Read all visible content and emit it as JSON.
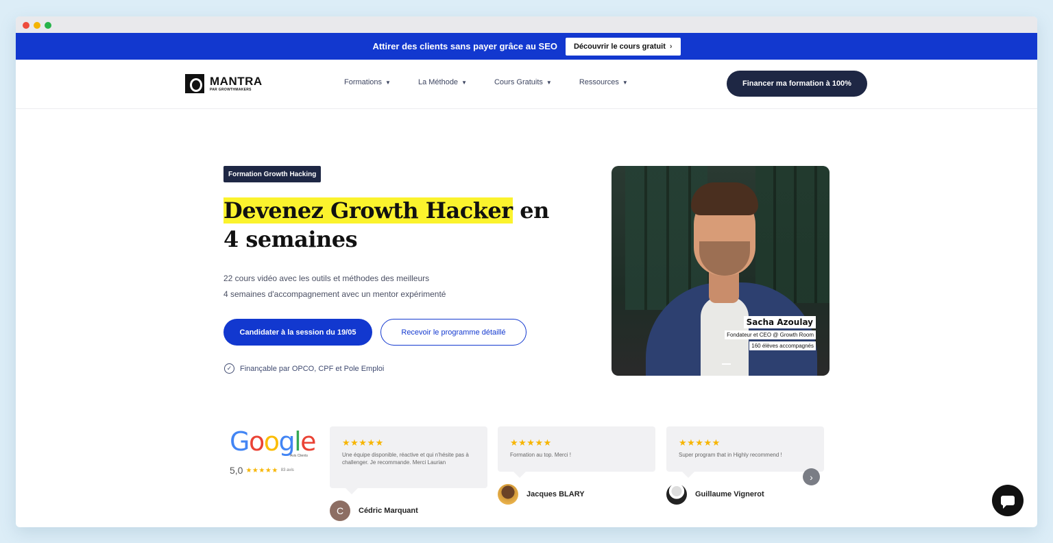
{
  "promo": {
    "text": "Attirer des clients sans payer grâce au SEO",
    "button": "Découvrir le cours gratuit",
    "button_icon": "chevron-right-icon"
  },
  "nav": {
    "logo_name": "MANTRA",
    "logo_sub": "PAR GROWTHMAKERS",
    "items": [
      {
        "label": "Formations"
      },
      {
        "label": "La Méthode"
      },
      {
        "label": "Cours Gratuits"
      },
      {
        "label": "Ressources"
      }
    ],
    "cta": "Financer ma formation à 100%"
  },
  "hero": {
    "badge": "Formation Growth Hacking",
    "headline_highlight": "Devenez Growth Hacker",
    "headline_rest_1": "en",
    "headline_rest_2": "4 semaines",
    "line_1": "22 cours vidéo avec les outils et méthodes des meilleurs",
    "line_2": "4 semaines d'accompagnement avec un mentor expérimenté",
    "primary_button": "Candidater à la session du 19/05",
    "secondary_button": "Recevoir le programme détaillé",
    "funding": "Finançable par OPCO, CPF et Pole Emploi"
  },
  "mentor": {
    "name": "Sacha Azoulay",
    "role": "Fondateur et CEO @ Growth Room",
    "students": "160 élèves accompagnés"
  },
  "google": {
    "subtitle": "Avis Clients",
    "score": "5,0",
    "stars": "★★★★★",
    "count": "83 avis"
  },
  "reviews": [
    {
      "stars": "★★★★★",
      "text": "Une équipe disponible, réactive et qui n'hésite pas à challenger. Je recommande. Merci Laurian",
      "author": "Cédric Marquant",
      "initial": "C"
    },
    {
      "stars": "★★★★★",
      "text": "Formation au top. Merci !",
      "author": "Jacques BLARY"
    },
    {
      "stars": "★★★★★",
      "text": "Super program that in Highly recommend !",
      "author": "Guillaume Vignerot"
    }
  ],
  "colors": {
    "brand_blue": "#1238cf",
    "navy": "#1e2744",
    "highlight": "#fbf32d",
    "star": "#f7b500"
  }
}
